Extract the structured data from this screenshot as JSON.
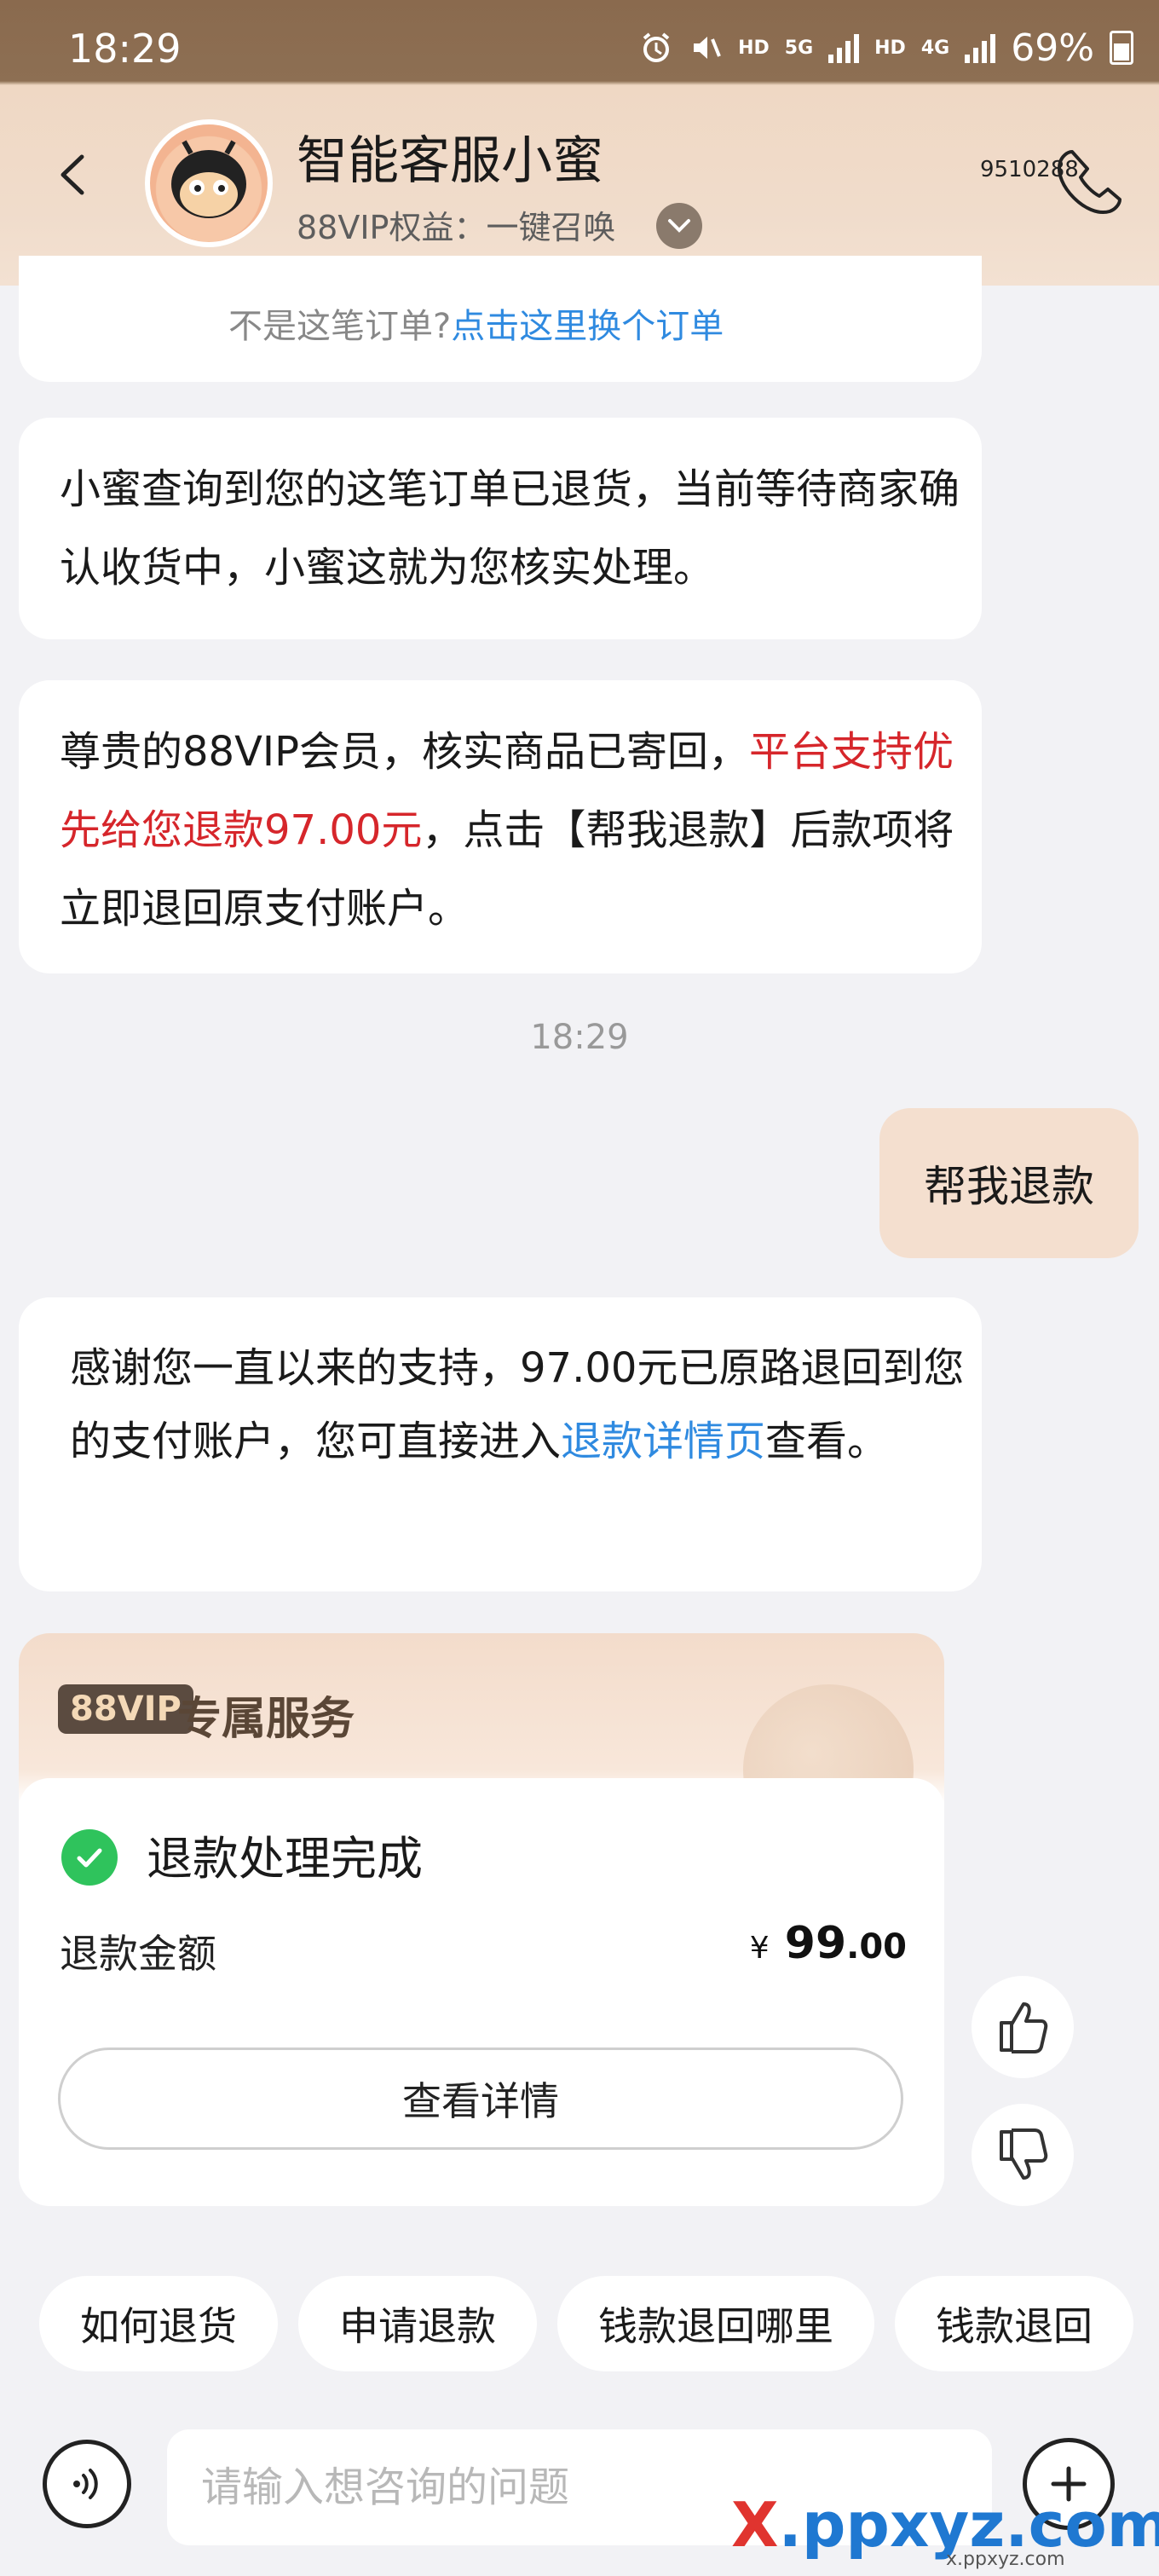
{
  "status_bar": {
    "time": "18:29",
    "hd1": "HD",
    "net1": "5G",
    "hd2": "HD",
    "net2": "4G",
    "battery": "69%"
  },
  "header": {
    "title": "智能客服小蜜",
    "subtitle": "88VIP权益：一键召唤",
    "phone_number": "9510288"
  },
  "messages": {
    "order_hint": "不是这笔订单?",
    "order_hint_link": "点击这里换个订单",
    "msg1": "小蜜查询到您的这笔订单已退货，当前等待商家确认收货中，小蜜这就为您核实处理。",
    "msg2_pre": "尊贵的88VIP会员，核实商品已寄回，",
    "msg2_highlight": "平台支持优先给您退款97.00元",
    "msg2_post": "，点击【帮我退款】后款项将立即退回原支付账户。",
    "timestamp": "18:29",
    "user_msg": "帮我退款",
    "msg3_pre": "感谢您一直以来的支持，97.00元已原路退回到您的支付账户，您可直接进入",
    "msg3_link": "退款详情页",
    "msg3_post": "查看。"
  },
  "vip_card": {
    "badge": "88VIP",
    "title": "专属服务",
    "status": "退款处理完成",
    "amount_label": "退款金额",
    "currency": "¥",
    "amount_int": "99",
    "amount_dec": ".00",
    "button": "查看详情"
  },
  "chips": [
    "如何退货",
    "申请退款",
    "钱款退回哪里",
    "钱款退回"
  ],
  "input": {
    "placeholder": "请输入想咨询的问题"
  },
  "watermark": {
    "brand_x": "X",
    "brand_rest": ".ppxyz.com",
    "sub": "x.ppxyz.com"
  },
  "colors": {
    "accent_red": "#d6262b",
    "link_blue": "#2f8ae0",
    "success_green": "#2fc35c"
  }
}
